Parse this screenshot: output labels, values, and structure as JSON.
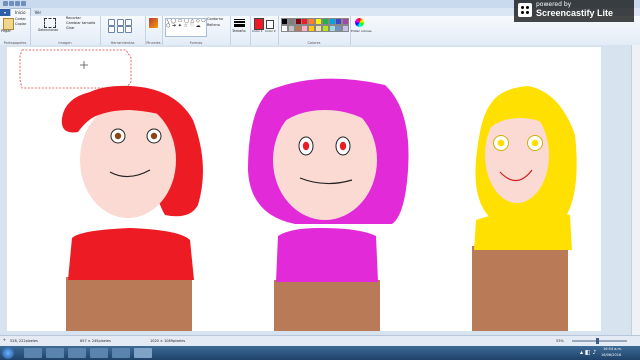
{
  "tabs": {
    "file": "",
    "home": "Inicio",
    "view": "Ver"
  },
  "ribbon": {
    "clipboard": {
      "paste": "Pegar",
      "cut": "Cortar",
      "copy": "Copiar",
      "label": "Portapapeles"
    },
    "image": {
      "select": "Seleccionar",
      "crop": "Recortar",
      "resize": "Cambiar tamaño",
      "rotate": "Girar",
      "label": "Imagen"
    },
    "tools": {
      "label": "Herramientas"
    },
    "brushes": {
      "label": "Pinceles"
    },
    "shapes": {
      "outline": "Contorno",
      "fill": "Relleno",
      "label": "Formas"
    },
    "size": {
      "label": "Tamaño"
    },
    "color1": {
      "label": "Color 1"
    },
    "color2": {
      "label": "Color 2"
    },
    "colors": {
      "label": "Colores"
    },
    "edit_colors": {
      "label": "Editar colores"
    }
  },
  "palette": [
    "#000000",
    "#7f7f7f",
    "#880015",
    "#ed1c24",
    "#ff7f27",
    "#fff200",
    "#22b14c",
    "#00a2e8",
    "#3f48cc",
    "#a349a4",
    "#ffffff",
    "#c3c3c3",
    "#b97a57",
    "#ffaec9",
    "#ffc90e",
    "#efe4b0",
    "#b5e61d",
    "#99d9ea",
    "#7092be",
    "#c8bfe7"
  ],
  "colors_meta": {
    "color1": "#ed1c24",
    "color2": "#ffffff",
    "accent": "#2d5fa8"
  },
  "status": {
    "cursor": "528, 222píxeles",
    "selection": "657 × 245píxeles",
    "image_size": "1020 × 1089píxeles",
    "zoom": "53%"
  },
  "taskbar": {
    "time": "16:54 a.m.",
    "date": "16/06/2016"
  },
  "watermark": {
    "line1": "powered by",
    "line2": "Screencastify Lite"
  }
}
